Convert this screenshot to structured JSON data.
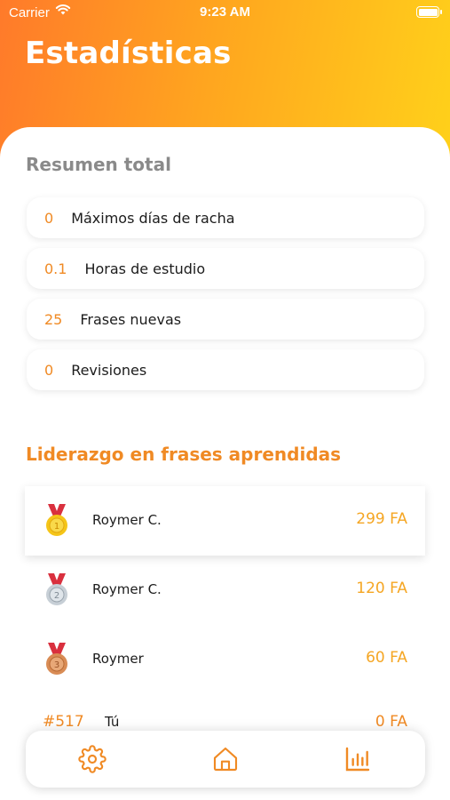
{
  "status_bar": {
    "carrier": "Carrier",
    "time": "9:23 AM"
  },
  "header": {
    "title": "Estadísticas"
  },
  "summary": {
    "title": "Resumen total",
    "items": [
      {
        "value": "0",
        "label": "Máximos días de racha"
      },
      {
        "value": "0.1",
        "label": "Horas de estudio"
      },
      {
        "value": "25",
        "label": "Frases nuevas"
      },
      {
        "value": "0",
        "label": "Revisiones"
      }
    ]
  },
  "leaderboard": {
    "title": "Liderazgo en frases aprendidas",
    "entries": [
      {
        "medal": "gold-medal-icon",
        "rank": 1,
        "name": "Roymer C.",
        "score": "299 FA"
      },
      {
        "medal": "silver-medal-icon",
        "rank": 2,
        "name": "Roymer C.",
        "score": "120 FA"
      },
      {
        "medal": "bronze-medal-icon",
        "rank": 3,
        "name": "Roymer",
        "score": "60 FA"
      }
    ],
    "me": {
      "rank": "#517",
      "name": "Tú",
      "score": "0 FA"
    }
  },
  "tabs": [
    {
      "icon": "settings-gear-icon",
      "active": false
    },
    {
      "icon": "home-icon",
      "active": false
    },
    {
      "icon": "bar-chart-icon",
      "active": true
    }
  ],
  "colors": {
    "accent": "#f08a24",
    "score": "#f5a623",
    "gradient_start": "#ff7a2a",
    "gradient_end": "#ffd21a",
    "gold": "#f5c518",
    "silver": "#c7cfd6",
    "bronze": "#d98c55",
    "ribbon": "#d9303e"
  }
}
